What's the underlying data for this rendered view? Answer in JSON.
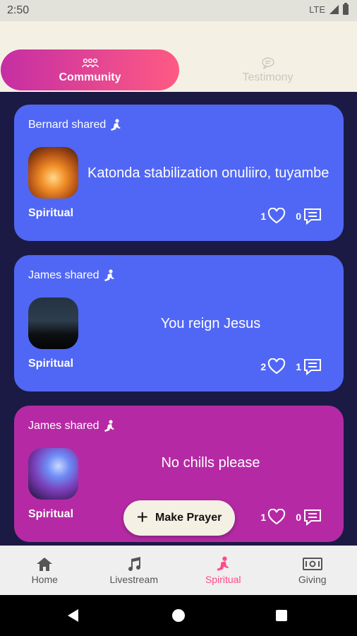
{
  "status": {
    "time": "2:50",
    "network": "LTE"
  },
  "tabs": [
    {
      "label": "Community",
      "icon": "people-icon",
      "active": true
    },
    {
      "label": "Testimony",
      "icon": "chat-icon",
      "active": false
    }
  ],
  "posts": [
    {
      "author_text": "Bernard shared",
      "message": "Katonda stabilization onuliiro, tuyambe",
      "category": "Spiritual",
      "likes": "1",
      "comments": "0",
      "color": "#5067f5"
    },
    {
      "author_text": "James shared",
      "message": "You reign Jesus",
      "category": "Spiritual",
      "likes": "2",
      "comments": "1",
      "color": "#5067f5"
    },
    {
      "author_text": "James shared",
      "message": "No chills please",
      "category": "Spiritual",
      "likes": "1",
      "comments": "0",
      "color": "#b52aa4"
    }
  ],
  "fab": {
    "label": "Make Prayer"
  },
  "nav": [
    {
      "label": "Home",
      "icon": "home-icon"
    },
    {
      "label": "Livestream",
      "icon": "music-note-icon"
    },
    {
      "label": "Spiritual",
      "icon": "praying-icon",
      "active": true
    },
    {
      "label": "Giving",
      "icon": "money-icon"
    }
  ],
  "colors": {
    "accent": "#ff4a8a",
    "header_bg": "#f4f1e4",
    "feed_bg": "#1b1a44",
    "card_blue": "#5067f5",
    "card_purple": "#b52aa4"
  }
}
